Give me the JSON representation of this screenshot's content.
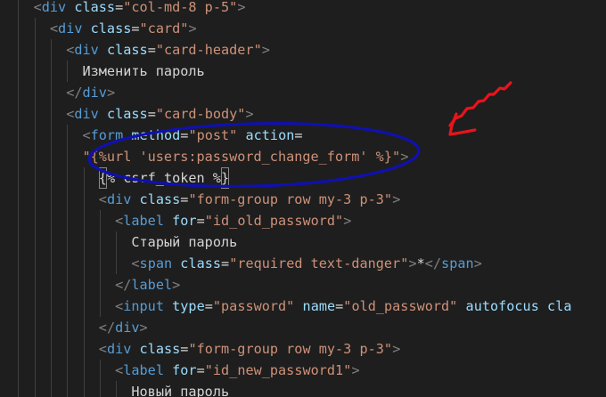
{
  "editor": {
    "theme": {
      "background": "#1e1e1e",
      "punctuation": "#808080",
      "tag": "#569cd6",
      "attribute": "#9cdcfe",
      "string": "#ce9178",
      "text": "#d4d4d4",
      "indent_guide": "#404040"
    },
    "lines": [
      {
        "indent": 2,
        "tokens": [
          {
            "t": "<",
            "c": "punct"
          },
          {
            "t": "div",
            "c": "tag"
          },
          {
            "t": " ",
            "c": "text"
          },
          {
            "t": "class",
            "c": "attr"
          },
          {
            "t": "=",
            "c": "text"
          },
          {
            "t": "\"col-md-8 p-5\"",
            "c": "str"
          },
          {
            "t": ">",
            "c": "punct"
          }
        ]
      },
      {
        "indent": 3,
        "tokens": [
          {
            "t": "<",
            "c": "punct"
          },
          {
            "t": "div",
            "c": "tag"
          },
          {
            "t": " ",
            "c": "text"
          },
          {
            "t": "class",
            "c": "attr"
          },
          {
            "t": "=",
            "c": "text"
          },
          {
            "t": "\"card\"",
            "c": "str"
          },
          {
            "t": ">",
            "c": "punct"
          }
        ]
      },
      {
        "indent": 4,
        "tokens": [
          {
            "t": "<",
            "c": "punct"
          },
          {
            "t": "div",
            "c": "tag"
          },
          {
            "t": " ",
            "c": "text"
          },
          {
            "t": "class",
            "c": "attr"
          },
          {
            "t": "=",
            "c": "text"
          },
          {
            "t": "\"card-header\"",
            "c": "str"
          },
          {
            "t": ">",
            "c": "punct"
          }
        ]
      },
      {
        "indent": 5,
        "tokens": [
          {
            "t": "Изменить пароль",
            "c": "text"
          }
        ]
      },
      {
        "indent": 4,
        "tokens": [
          {
            "t": "</",
            "c": "punct"
          },
          {
            "t": "div",
            "c": "tag"
          },
          {
            "t": ">",
            "c": "punct"
          }
        ]
      },
      {
        "indent": 4,
        "tokens": [
          {
            "t": "<",
            "c": "punct"
          },
          {
            "t": "div",
            "c": "tag"
          },
          {
            "t": " ",
            "c": "text"
          },
          {
            "t": "class",
            "c": "attr"
          },
          {
            "t": "=",
            "c": "text"
          },
          {
            "t": "\"card-body\"",
            "c": "str"
          },
          {
            "t": ">",
            "c": "punct"
          }
        ]
      },
      {
        "indent": 5,
        "tokens": [
          {
            "t": "<",
            "c": "punct"
          },
          {
            "t": "form",
            "c": "tag"
          },
          {
            "t": " ",
            "c": "text"
          },
          {
            "t": "method",
            "c": "attr"
          },
          {
            "t": "=",
            "c": "text"
          },
          {
            "t": "\"post\"",
            "c": "str"
          },
          {
            "t": " ",
            "c": "text"
          },
          {
            "t": "action",
            "c": "attr"
          },
          {
            "t": "=",
            "c": "text"
          }
        ]
      },
      {
        "indent": 5,
        "tokens": [
          {
            "t": "\"{%url 'users:password_change_form' %}\"",
            "c": "str"
          },
          {
            "t": ">",
            "c": "punct"
          }
        ]
      },
      {
        "indent": 6,
        "tokens": [
          {
            "t": "{",
            "c": "text",
            "match": true
          },
          {
            "t": "% csrf_token %",
            "c": "text"
          },
          {
            "t": "}",
            "c": "text",
            "match": true
          }
        ]
      },
      {
        "indent": 6,
        "tokens": [
          {
            "t": "<",
            "c": "punct"
          },
          {
            "t": "div",
            "c": "tag"
          },
          {
            "t": " ",
            "c": "text"
          },
          {
            "t": "class",
            "c": "attr"
          },
          {
            "t": "=",
            "c": "text"
          },
          {
            "t": "\"form-group row my-3 p-3\"",
            "c": "str"
          },
          {
            "t": ">",
            "c": "punct"
          }
        ]
      },
      {
        "indent": 7,
        "tokens": [
          {
            "t": "<",
            "c": "punct"
          },
          {
            "t": "label",
            "c": "tag"
          },
          {
            "t": " ",
            "c": "text"
          },
          {
            "t": "for",
            "c": "attr"
          },
          {
            "t": "=",
            "c": "text"
          },
          {
            "t": "\"id_old_password\"",
            "c": "str"
          },
          {
            "t": ">",
            "c": "punct"
          }
        ]
      },
      {
        "indent": 8,
        "tokens": [
          {
            "t": "Старый пароль",
            "c": "text"
          }
        ]
      },
      {
        "indent": 8,
        "tokens": [
          {
            "t": "<",
            "c": "punct"
          },
          {
            "t": "span",
            "c": "tag"
          },
          {
            "t": " ",
            "c": "text"
          },
          {
            "t": "class",
            "c": "attr"
          },
          {
            "t": "=",
            "c": "text"
          },
          {
            "t": "\"required text-danger\"",
            "c": "str"
          },
          {
            "t": ">",
            "c": "punct"
          },
          {
            "t": "*",
            "c": "text"
          },
          {
            "t": "</",
            "c": "punct"
          },
          {
            "t": "span",
            "c": "tag"
          },
          {
            "t": ">",
            "c": "punct"
          }
        ]
      },
      {
        "indent": 7,
        "tokens": [
          {
            "t": "</",
            "c": "punct"
          },
          {
            "t": "label",
            "c": "tag"
          },
          {
            "t": ">",
            "c": "punct"
          }
        ]
      },
      {
        "indent": 7,
        "tokens": [
          {
            "t": "<",
            "c": "punct"
          },
          {
            "t": "input",
            "c": "tag"
          },
          {
            "t": " ",
            "c": "text"
          },
          {
            "t": "type",
            "c": "attr"
          },
          {
            "t": "=",
            "c": "text"
          },
          {
            "t": "\"password\"",
            "c": "str"
          },
          {
            "t": " ",
            "c": "text"
          },
          {
            "t": "name",
            "c": "attr"
          },
          {
            "t": "=",
            "c": "text"
          },
          {
            "t": "\"old_password\"",
            "c": "str"
          },
          {
            "t": " ",
            "c": "text"
          },
          {
            "t": "autofocus",
            "c": "attr"
          },
          {
            "t": " ",
            "c": "text"
          },
          {
            "t": "cla",
            "c": "attr"
          }
        ]
      },
      {
        "indent": 6,
        "tokens": [
          {
            "t": "</",
            "c": "punct"
          },
          {
            "t": "div",
            "c": "tag"
          },
          {
            "t": ">",
            "c": "punct"
          }
        ]
      },
      {
        "indent": 6,
        "tokens": [
          {
            "t": "<",
            "c": "punct"
          },
          {
            "t": "div",
            "c": "tag"
          },
          {
            "t": " ",
            "c": "text"
          },
          {
            "t": "class",
            "c": "attr"
          },
          {
            "t": "=",
            "c": "text"
          },
          {
            "t": "\"form-group row my-3 p-3\"",
            "c": "str"
          },
          {
            "t": ">",
            "c": "punct"
          }
        ]
      },
      {
        "indent": 7,
        "tokens": [
          {
            "t": "<",
            "c": "punct"
          },
          {
            "t": "label",
            "c": "tag"
          },
          {
            "t": " ",
            "c": "text"
          },
          {
            "t": "for",
            "c": "attr"
          },
          {
            "t": "=",
            "c": "text"
          },
          {
            "t": "\"id_new_password1\"",
            "c": "str"
          },
          {
            "t": ">",
            "c": "punct"
          }
        ]
      },
      {
        "indent": 8,
        "tokens": [
          {
            "t": "Новый пароль",
            "c": "text"
          }
        ]
      }
    ]
  },
  "annotations": {
    "ellipse_color": "#1010b0",
    "arrow_color": "#e8141c"
  }
}
